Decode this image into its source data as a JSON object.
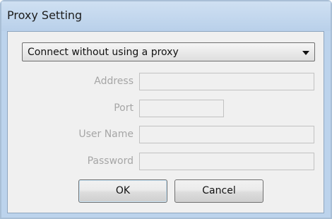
{
  "window": {
    "title": "Proxy Setting"
  },
  "proxy_mode": {
    "selected": "Connect without using a proxy",
    "arrow_icon": "dropdown-arrow-icon"
  },
  "fields": {
    "address_label": "Address",
    "address_value": "",
    "port_label": "Port",
    "port_value": "",
    "username_label": "User Name",
    "username_value": "",
    "password_label": "Password",
    "password_value": ""
  },
  "buttons": {
    "ok": "OK",
    "cancel": "Cancel"
  }
}
